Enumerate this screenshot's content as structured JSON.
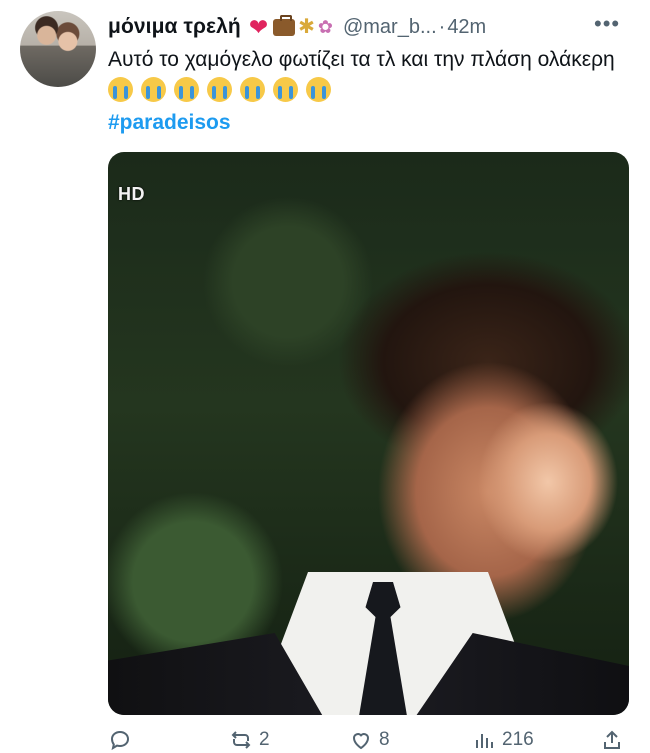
{
  "tweet": {
    "display_name": "μόνιμα τρελή",
    "handle": "@mar_b...",
    "separator": "·",
    "time": "42m",
    "text_line": "Αυτό το χαμόγελο φωτίζει τα τλ και την πλάση ολάκερη",
    "hashtag": "#paradeisos",
    "media_badge": "HD",
    "emoji_icons": [
      "heart-icon",
      "briefcase-icon",
      "wheat-icon",
      "candy-icon"
    ],
    "sob_count": 7
  },
  "actions": {
    "reply_count": "",
    "retweet_count": "2",
    "like_count": "8",
    "views_count": "216"
  },
  "colors": {
    "accent": "#1d9bf0",
    "secondary_text": "#536471",
    "heart": "#e0245e"
  }
}
